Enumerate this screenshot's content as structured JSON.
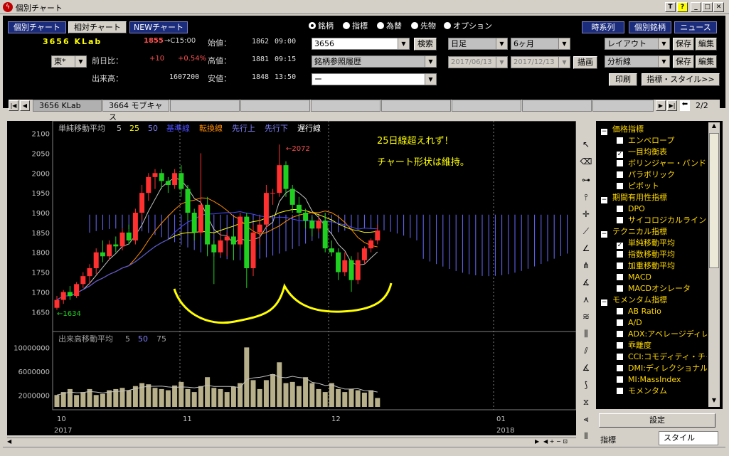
{
  "window": {
    "title": "個別チャート",
    "ctrl": [
      "T",
      "?",
      "_",
      "□",
      "✕"
    ]
  },
  "nav": {
    "btn1": "個別チャート",
    "btn2": "相対チャート",
    "btn3": "NEWチャート"
  },
  "radios": [
    "銘柄",
    "指標",
    "為替",
    "先物",
    "オプション"
  ],
  "right_buttons": [
    "時系列",
    "個別銘柄",
    "ニュース"
  ],
  "stock": {
    "code_name": "3656 KLab",
    "price": "1855",
    "arrow": "→C15:00",
    "market": "東*",
    "prev_label": "前日比：",
    "change": "+10",
    "change_pct": "+0.54%",
    "vol_label": "出来高：",
    "volume": "1607200",
    "open_label": "始値：",
    "open": "1862",
    "open_t": "09:00",
    "high_label": "高値：",
    "high": "1881",
    "high_t": "09:15",
    "low_label": "安値：",
    "low": "1848",
    "low_t": "13:50"
  },
  "search": {
    "code": "3656",
    "search_btn": "検索",
    "history": "銘柄参照履歴",
    "blank": "ー"
  },
  "period": {
    "freq": "日足",
    "range": "6ヶ月",
    "from": "2017/06/13",
    "to": "2017/12/13",
    "draw": "描画"
  },
  "layout": {
    "layout": "レイアウト",
    "save1": "保存",
    "edit1": "編集",
    "analysis": "分析線",
    "save2": "保存",
    "edit2": "編集",
    "print": "印刷",
    "style": "指標・スタイル>>"
  },
  "tabs": {
    "t1": "3656 KLab",
    "t2": "3664 モブキャス",
    "page": "2/2"
  },
  "chart": {
    "legend": [
      {
        "t": "単純移動平均",
        "c": "#c0c0c0"
      },
      {
        "t": "5",
        "c": "#c0c0c0"
      },
      {
        "t": "25",
        "c": "#ffff00"
      },
      {
        "t": "50",
        "c": "#8080ff"
      },
      {
        "t": "基準線",
        "c": "#4a4aff"
      },
      {
        "t": "転換線",
        "c": "#ff8c00"
      },
      {
        "t": "先行上",
        "c": "#8080ff"
      },
      {
        "t": "先行下",
        "c": "#8080ff"
      },
      {
        "t": "遅行線",
        "c": "#ffffff"
      }
    ],
    "note1": "25日線超えれず！",
    "note2": "チャート形状は維持。",
    "hi_label": "←2072",
    "lo_label": "←1634",
    "y_ticks": [
      "2100",
      "2050",
      "2000",
      "1950",
      "1900",
      "1850",
      "1800",
      "1750",
      "1700",
      "1650"
    ],
    "vol_legend": [
      {
        "t": "出来高移動平均",
        "c": "#a0a0a0"
      },
      {
        "t": "5",
        "c": "#a0a0a0"
      },
      {
        "t": "50",
        "c": "#8080ff"
      },
      {
        "t": "75",
        "c": "#a0a0a0"
      }
    ],
    "vol_ticks": [
      "10000000",
      "6000000",
      "2000000"
    ],
    "x_labels": [
      "10",
      "11",
      "12",
      "01"
    ],
    "years": [
      "2017",
      "2018"
    ]
  },
  "chart_data": {
    "type": "candlestick",
    "ylim": [
      1620,
      2110
    ],
    "candles": [
      [
        1660,
        1680,
        1655,
        1690
      ],
      [
        1680,
        1700,
        1670,
        1705
      ],
      [
        1700,
        1690,
        1680,
        1715
      ],
      [
        1690,
        1720,
        1685,
        1725
      ],
      [
        1720,
        1740,
        1710,
        1750
      ],
      [
        1740,
        1760,
        1720,
        1770
      ],
      [
        1760,
        1800,
        1745,
        1810
      ],
      [
        1800,
        1790,
        1775,
        1830
      ],
      [
        1790,
        1820,
        1780,
        1830
      ],
      [
        1820,
        1815,
        1800,
        1840
      ],
      [
        1815,
        1850,
        1805,
        1860
      ],
      [
        1850,
        1830,
        1820,
        1870
      ],
      [
        1830,
        1900,
        1820,
        1910
      ],
      [
        1900,
        1950,
        1880,
        1970
      ],
      [
        1950,
        1990,
        1930,
        2000
      ],
      [
        1990,
        2000,
        1960,
        2010
      ],
      [
        2000,
        1980,
        1960,
        2010
      ],
      [
        1980,
        1970,
        1950,
        1990
      ],
      [
        1970,
        2000,
        1960,
        2010
      ],
      [
        2000,
        1960,
        1940,
        2020
      ],
      [
        1960,
        1900,
        1880,
        1970
      ],
      [
        1900,
        1850,
        1830,
        1910
      ],
      [
        1850,
        1920,
        1840,
        2050
      ],
      [
        1920,
        1820,
        1790,
        1940
      ],
      [
        1820,
        1800,
        1720,
        1830
      ],
      [
        1800,
        1830,
        1790,
        1850
      ],
      [
        1830,
        1840,
        1790,
        1850
      ],
      [
        1840,
        1820,
        1780,
        1860
      ],
      [
        1820,
        1890,
        1810,
        1900
      ],
      [
        1890,
        1760,
        1710,
        1900
      ],
      [
        1760,
        1850,
        1740,
        1870
      ],
      [
        1850,
        1870,
        1820,
        1890
      ],
      [
        1870,
        1950,
        1860,
        1970
      ],
      [
        1950,
        1950,
        1920,
        1960
      ],
      [
        1950,
        2020,
        1940,
        2072
      ],
      [
        2020,
        1960,
        1940,
        2030
      ],
      [
        1960,
        1920,
        1900,
        1970
      ],
      [
        1920,
        1900,
        1890,
        1940
      ],
      [
        1900,
        1880,
        1860,
        1910
      ],
      [
        1880,
        1860,
        1840,
        1890
      ],
      [
        1860,
        1880,
        1850,
        1890
      ],
      [
        1880,
        1810,
        1800,
        1900
      ],
      [
        1810,
        1800,
        1790,
        1830
      ],
      [
        1800,
        1750,
        1730,
        1810
      ],
      [
        1750,
        1780,
        1740,
        1800
      ],
      [
        1780,
        1730,
        1700,
        1790
      ],
      [
        1730,
        1780,
        1720,
        1800
      ],
      [
        1780,
        1810,
        1770,
        1815
      ],
      [
        1810,
        1830,
        1800,
        1835
      ],
      [
        1830,
        1855,
        1820,
        1870
      ]
    ],
    "volume": [
      2,
      2.5,
      3,
      2,
      2.5,
      3,
      2,
      2.2,
      2.8,
      3,
      3.2,
      2.8,
      3.5,
      4,
      3.8,
      3.2,
      3,
      2.8,
      3.6,
      4.2,
      3,
      2.5,
      3.5,
      5,
      3.2,
      3,
      2.5,
      3.4,
      4,
      10,
      4.5,
      3,
      4.5,
      5.5,
      7.5,
      4,
      4.2,
      3.5,
      5,
      4,
      3,
      2.5,
      4,
      3,
      2.5,
      3,
      2.8,
      2.4,
      2.8,
      1.5
    ],
    "volume_unit": "1000000"
  },
  "panel": {
    "items": [
      {
        "t": "価格指標",
        "hdr": true,
        "chk": false
      },
      {
        "t": "エンベロープ",
        "chk": false
      },
      {
        "t": "一目均衡表",
        "chk": true
      },
      {
        "t": "ボリンジャー・バンド",
        "chk": false
      },
      {
        "t": "パラボリック",
        "chk": false
      },
      {
        "t": "ピボット",
        "chk": false
      },
      {
        "t": "期間有用性指標",
        "hdr": true,
        "chk": false
      },
      {
        "t": "DPO",
        "chk": false
      },
      {
        "t": "サイコロジカルライン",
        "chk": false
      },
      {
        "t": "テクニカル指標",
        "hdr": true,
        "chk": false
      },
      {
        "t": "単純移動平均",
        "chk": true
      },
      {
        "t": "指数移動平均",
        "chk": false
      },
      {
        "t": "加重移動平均",
        "chk": false
      },
      {
        "t": "MACD",
        "chk": false
      },
      {
        "t": "MACDオシレータ",
        "chk": false
      },
      {
        "t": "モメンタム指標",
        "hdr": true,
        "chk": false
      },
      {
        "t": "AB Ratio",
        "chk": false
      },
      {
        "t": "A/D",
        "chk": false
      },
      {
        "t": "ADX:アベレージディレ",
        "chk": false
      },
      {
        "t": "乖離度",
        "chk": false
      },
      {
        "t": "CCI:コモディティ・チャ",
        "chk": false
      },
      {
        "t": "DMI:ディレクショナル",
        "chk": false
      },
      {
        "t": "MI:MassIndex",
        "chk": false
      },
      {
        "t": "モメンタム",
        "chk": false
      }
    ],
    "settings": "設定",
    "tab_indicator": "指標",
    "tab_style": "スタイル"
  }
}
